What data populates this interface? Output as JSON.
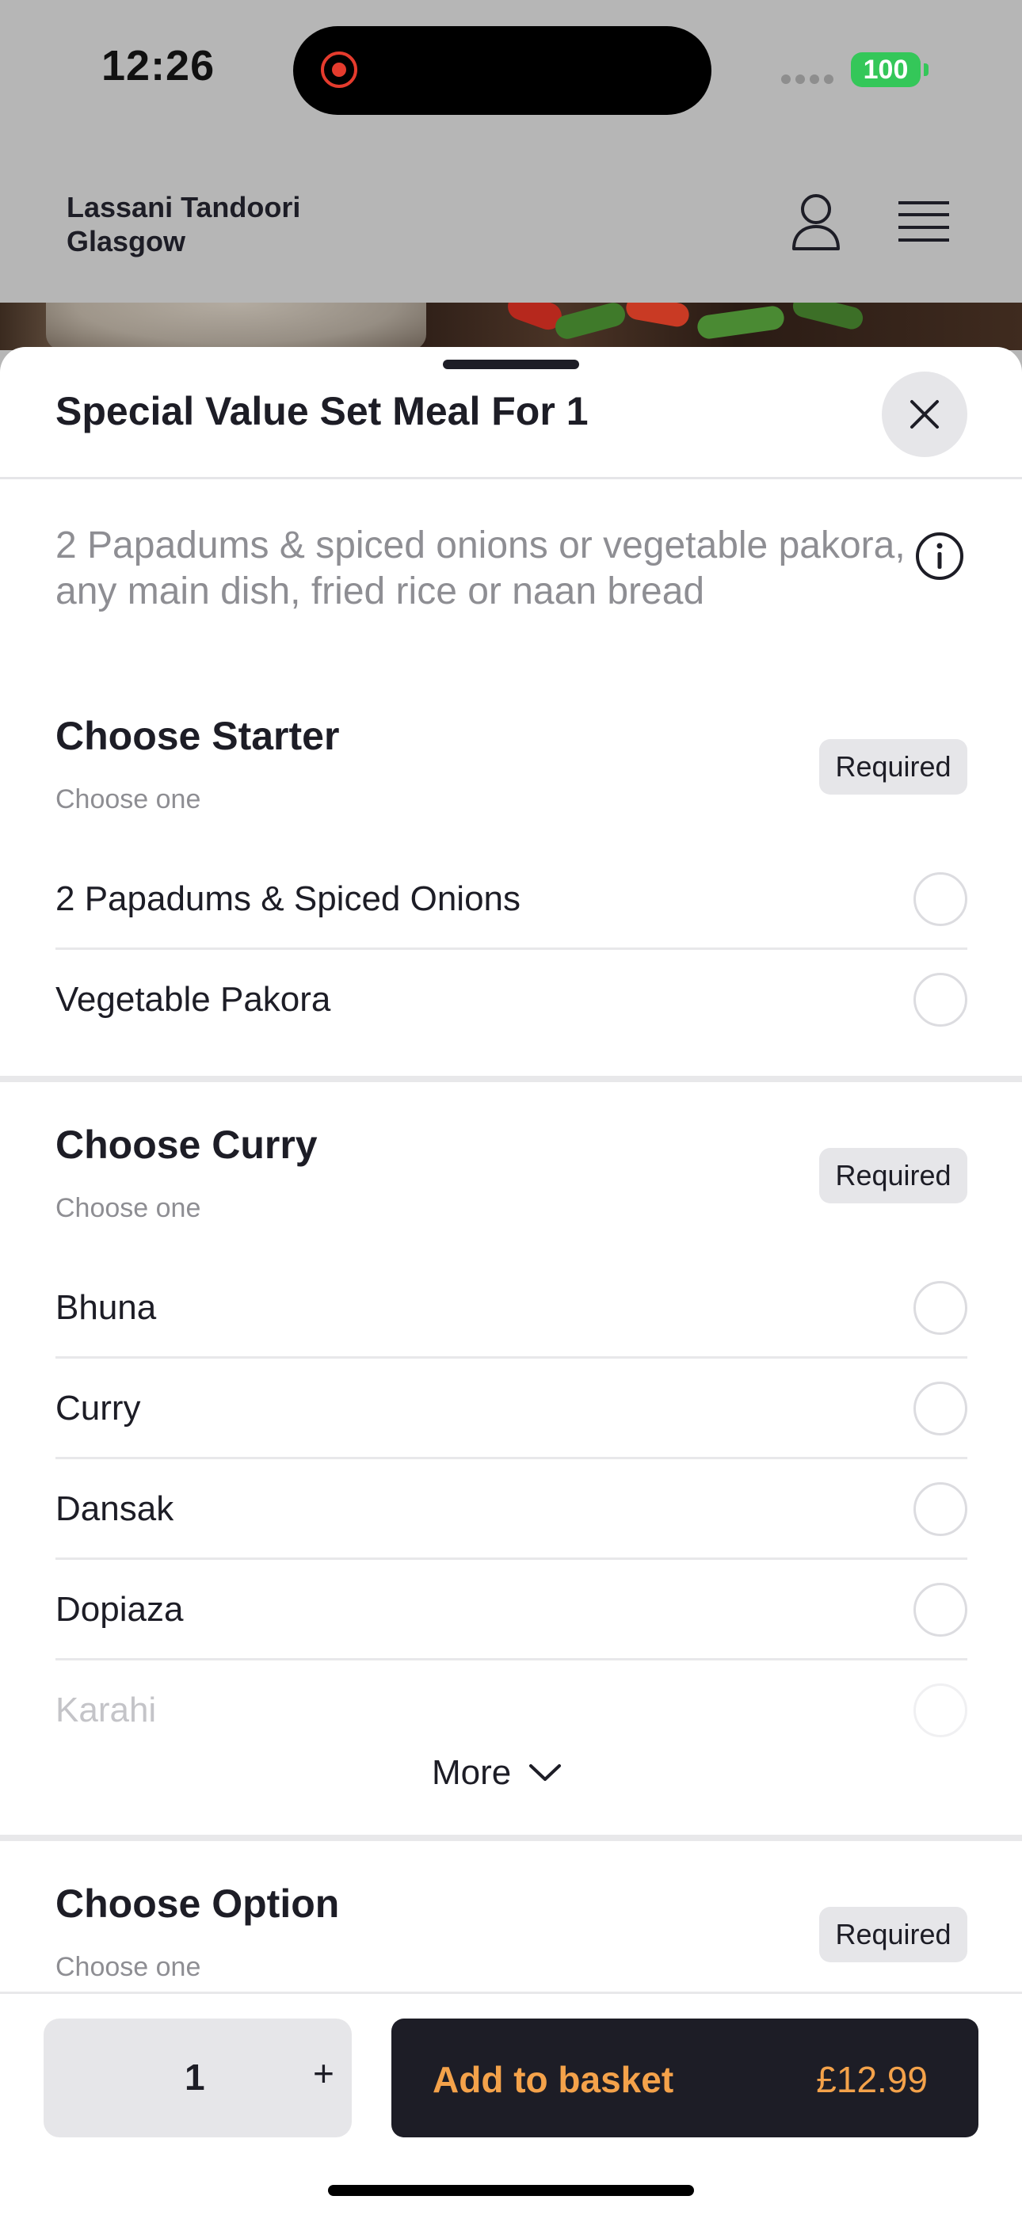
{
  "status_bar": {
    "time": "12:26",
    "battery": "100",
    "colors": {
      "battery": "#34c759",
      "recording": "#e53b2d"
    }
  },
  "header": {
    "restaurant_name": "Lassani Tandoori Glasgow",
    "icons": [
      "user-icon",
      "hamburger-menu-icon"
    ]
  },
  "sheet": {
    "title": "Special Value Set Meal For 1",
    "description": "2 Papadums & spiced onions or vegetable pakora, any main dish, fried rice or naan bread",
    "icons": [
      "close-icon",
      "info-icon"
    ]
  },
  "sections": [
    {
      "title": "Choose Starter",
      "subtitle": "Choose one",
      "badge": "Required",
      "options": [
        "2 Papadums & Spiced Onions",
        "Vegetable Pakora"
      ]
    },
    {
      "title": "Choose Curry",
      "subtitle": "Choose one",
      "badge": "Required",
      "options": [
        "Bhuna",
        "Curry",
        "Dansak",
        "Dopiaza",
        "Karahi"
      ],
      "more_label": "More"
    },
    {
      "title": "Choose Option",
      "subtitle": "Choose one",
      "badge": "Required"
    }
  ],
  "footer": {
    "quantity": "1",
    "plus_label": "+",
    "add_label": "Add to basket",
    "price": "£12.99",
    "colors": {
      "button_bg": "#1d1d26",
      "button_text": "#f4a24a"
    }
  }
}
